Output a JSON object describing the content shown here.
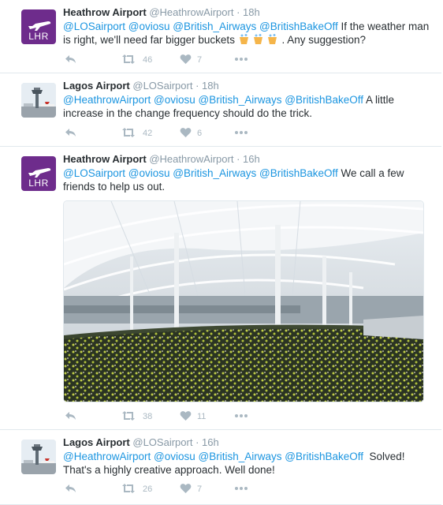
{
  "tweets": [
    {
      "name": "Heathrow Airport",
      "handle": "@HeathrowAirport",
      "sep": "·",
      "time": "18h",
      "avatar_text": "LHR",
      "text_parts": [
        "@LOSairport",
        " ",
        "@oviosu",
        " ",
        "@British_Airways",
        " ",
        "@BritishBakeOff",
        " If the weather man is right, we'll need far bigger buckets ",
        " . Any suggestion?"
      ],
      "retweets": "46",
      "likes": "7"
    },
    {
      "name": "Lagos Airport",
      "handle": "@LOSairport",
      "sep": "·",
      "time": "18h",
      "text_parts": [
        "@HeathrowAirport",
        " ",
        "@oviosu",
        " ",
        "@British_Airways",
        " ",
        "@BritishBakeOff",
        " A little increase in the change frequency should do the trick."
      ],
      "retweets": "42",
      "likes": "6"
    },
    {
      "name": "Heathrow Airport",
      "handle": "@HeathrowAirport",
      "sep": "·",
      "time": "16h",
      "avatar_text": "LHR",
      "text_parts": [
        "@LOSairport",
        " ",
        "@oviosu",
        " ",
        "@British_Airways",
        " ",
        "@BritishBakeOff",
        " We call a few friends to help us out."
      ],
      "retweets": "38",
      "likes": "11"
    },
    {
      "name": "Lagos Airport",
      "handle": "@LOSairport",
      "sep": "·",
      "time": "16h",
      "text_parts": [
        "@HeathrowAirport",
        " ",
        "@oviosu",
        " ",
        "@British_Airways",
        " ",
        "@BritishBakeOff",
        "  Solved! That's a highly creative approach. Well done!"
      ],
      "retweets": "26",
      "likes": "7"
    }
  ],
  "colors": {
    "mention": "#1b95e0",
    "muted": "#8899a6",
    "icon": "#aab8c2",
    "lhr_purple": "#6e2c8c"
  }
}
